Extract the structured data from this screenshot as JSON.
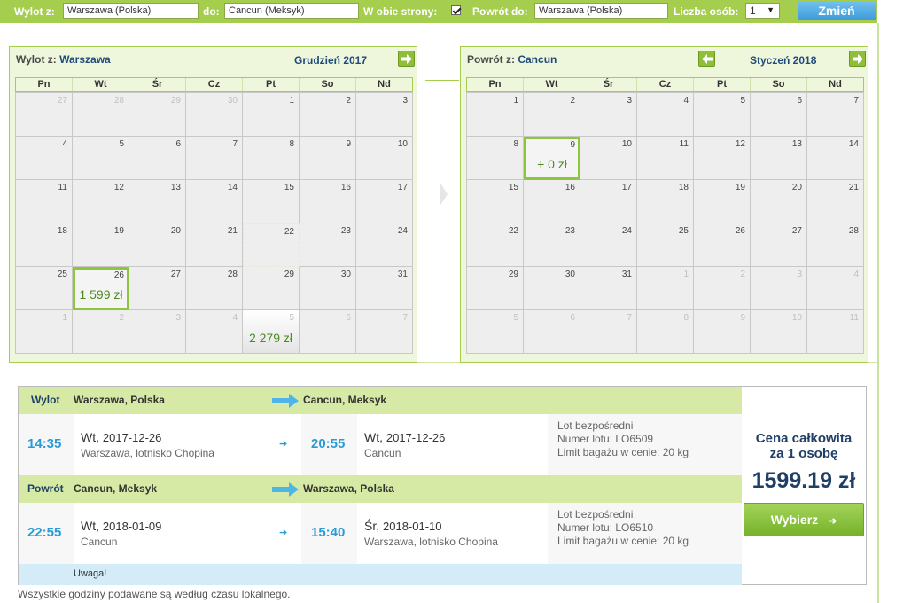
{
  "search": {
    "from_label": "Wylot z:",
    "from_value": "Warszawa (Polska)",
    "to_label": "do:",
    "to_value": "Cancun (Meksyk)",
    "roundtrip_label": "W obie strony:",
    "roundtrip_checked": true,
    "return_label": "Powrót do:",
    "return_value": "Warszawa (Polska)",
    "persons_label": "Liczba osób:",
    "persons_value": "1",
    "change_button": "Zmień"
  },
  "dow": [
    "Pn",
    "Wt",
    "Śr",
    "Cz",
    "Pt",
    "So",
    "Nd"
  ],
  "outbound_calendar": {
    "label": "Wylot z:",
    "city": "Warszawa",
    "month": "Grudzień 2017",
    "days": [
      {
        "n": "27",
        "m": true
      },
      {
        "n": "28",
        "m": true
      },
      {
        "n": "29",
        "m": true
      },
      {
        "n": "30",
        "m": true
      },
      {
        "n": "1"
      },
      {
        "n": "2"
      },
      {
        "n": "3"
      },
      {
        "n": "4"
      },
      {
        "n": "5"
      },
      {
        "n": "6"
      },
      {
        "n": "7"
      },
      {
        "n": "8"
      },
      {
        "n": "9"
      },
      {
        "n": "10"
      },
      {
        "n": "11"
      },
      {
        "n": "12"
      },
      {
        "n": "13"
      },
      {
        "n": "14"
      },
      {
        "n": "15"
      },
      {
        "n": "16"
      },
      {
        "n": "17"
      },
      {
        "n": "18"
      },
      {
        "n": "19"
      },
      {
        "n": "20"
      },
      {
        "n": "21"
      },
      {
        "n": "22",
        "o": true
      },
      {
        "n": "23"
      },
      {
        "n": "24"
      },
      {
        "n": "25"
      },
      {
        "n": "26",
        "s": true,
        "price": "1 599 zł"
      },
      {
        "n": "27"
      },
      {
        "n": "28"
      },
      {
        "n": "29"
      },
      {
        "n": "30"
      },
      {
        "n": "31"
      },
      {
        "n": "1",
        "m": true
      },
      {
        "n": "2",
        "m": true
      },
      {
        "n": "3",
        "m": true
      },
      {
        "n": "4",
        "m": true
      },
      {
        "n": "5",
        "m": true,
        "p": true,
        "price": "2 279 zł"
      },
      {
        "n": "6",
        "m": true
      },
      {
        "n": "7",
        "m": true
      }
    ]
  },
  "return_calendar": {
    "label": "Powrót z:",
    "city": "Cancun",
    "month": "Styczeń 2018",
    "days": [
      {
        "n": "1"
      },
      {
        "n": "2"
      },
      {
        "n": "3"
      },
      {
        "n": "4"
      },
      {
        "n": "5"
      },
      {
        "n": "6"
      },
      {
        "n": "7"
      },
      {
        "n": "8"
      },
      {
        "n": "9",
        "s": true,
        "price": "+ 0 zł"
      },
      {
        "n": "10"
      },
      {
        "n": "11"
      },
      {
        "n": "12"
      },
      {
        "n": "13"
      },
      {
        "n": "14"
      },
      {
        "n": "15"
      },
      {
        "n": "16"
      },
      {
        "n": "17"
      },
      {
        "n": "18"
      },
      {
        "n": "19"
      },
      {
        "n": "20"
      },
      {
        "n": "21"
      },
      {
        "n": "22"
      },
      {
        "n": "23"
      },
      {
        "n": "24"
      },
      {
        "n": "25"
      },
      {
        "n": "26"
      },
      {
        "n": "27"
      },
      {
        "n": "28"
      },
      {
        "n": "29"
      },
      {
        "n": "30"
      },
      {
        "n": "31"
      },
      {
        "n": "1",
        "m": true
      },
      {
        "n": "2",
        "m": true
      },
      {
        "n": "3",
        "m": true
      },
      {
        "n": "4",
        "m": true
      },
      {
        "n": "5",
        "m": true
      },
      {
        "n": "6",
        "m": true
      },
      {
        "n": "7",
        "m": true
      },
      {
        "n": "8",
        "m": true
      },
      {
        "n": "9",
        "m": true
      },
      {
        "n": "10",
        "m": true
      },
      {
        "n": "11",
        "m": true
      }
    ]
  },
  "summary": {
    "outbound": {
      "label": "Wylot",
      "from": "Warszawa, Polska",
      "to": "Cancun, Meksyk",
      "dep_time": "14:35",
      "dep_day": "Wt,",
      "dep_date": "2017-12-26",
      "dep_place": "Warszawa, lotnisko Chopina",
      "arr_time": "20:55",
      "arr_day": "Wt,",
      "arr_date": "2017-12-26",
      "arr_place": "Cancun",
      "info1": "Lot bezpośredni",
      "info2": "Numer lotu: LO6509",
      "info3": "Limit bagażu w cenie: 20 kg"
    },
    "return": {
      "label": "Powrót",
      "from": "Cancun, Meksyk",
      "to": "Warszawa, Polska",
      "dep_time": "22:55",
      "dep_day": "Wt,",
      "dep_date": "2018-01-09",
      "dep_place": "Cancun",
      "arr_time": "15:40",
      "arr_day": "Śr,",
      "arr_date": "2018-01-10",
      "arr_place": "Warszawa, lotnisko Chopina",
      "info1": "Lot bezpośredni",
      "info2": "Numer lotu: LO6510",
      "info3": "Limit bagażu w cenie: 20 kg"
    },
    "warning": "Uwaga!",
    "price_label_1": "Cena całkowita",
    "price_label_2": "za 1 osobę",
    "price_value": "1599.19 zł",
    "choose_button": "Wybierz"
  },
  "footer_note": "Wszystkie godziny podawane są według czasu lokalnego.",
  "colors": {
    "accent_green": "#a5cd4e",
    "price_green": "#4d8a1f",
    "time_blue": "#2a9bd6",
    "navy": "#1f3f66"
  }
}
